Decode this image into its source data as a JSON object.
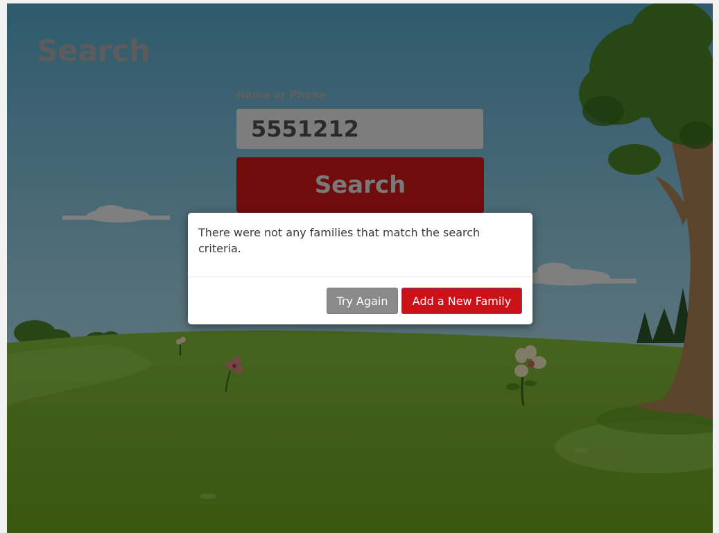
{
  "page": {
    "title": "Search"
  },
  "search": {
    "label": "Name or Phone",
    "value": "5551212",
    "button_label": "Search"
  },
  "dialog": {
    "message": "There were not any families that match the search criteria.",
    "try_again_label": "Try Again",
    "add_family_label": "Add a New Family"
  },
  "colors": {
    "accent_red": "#cc1119",
    "secondary_gray": "#8a8a8a"
  }
}
